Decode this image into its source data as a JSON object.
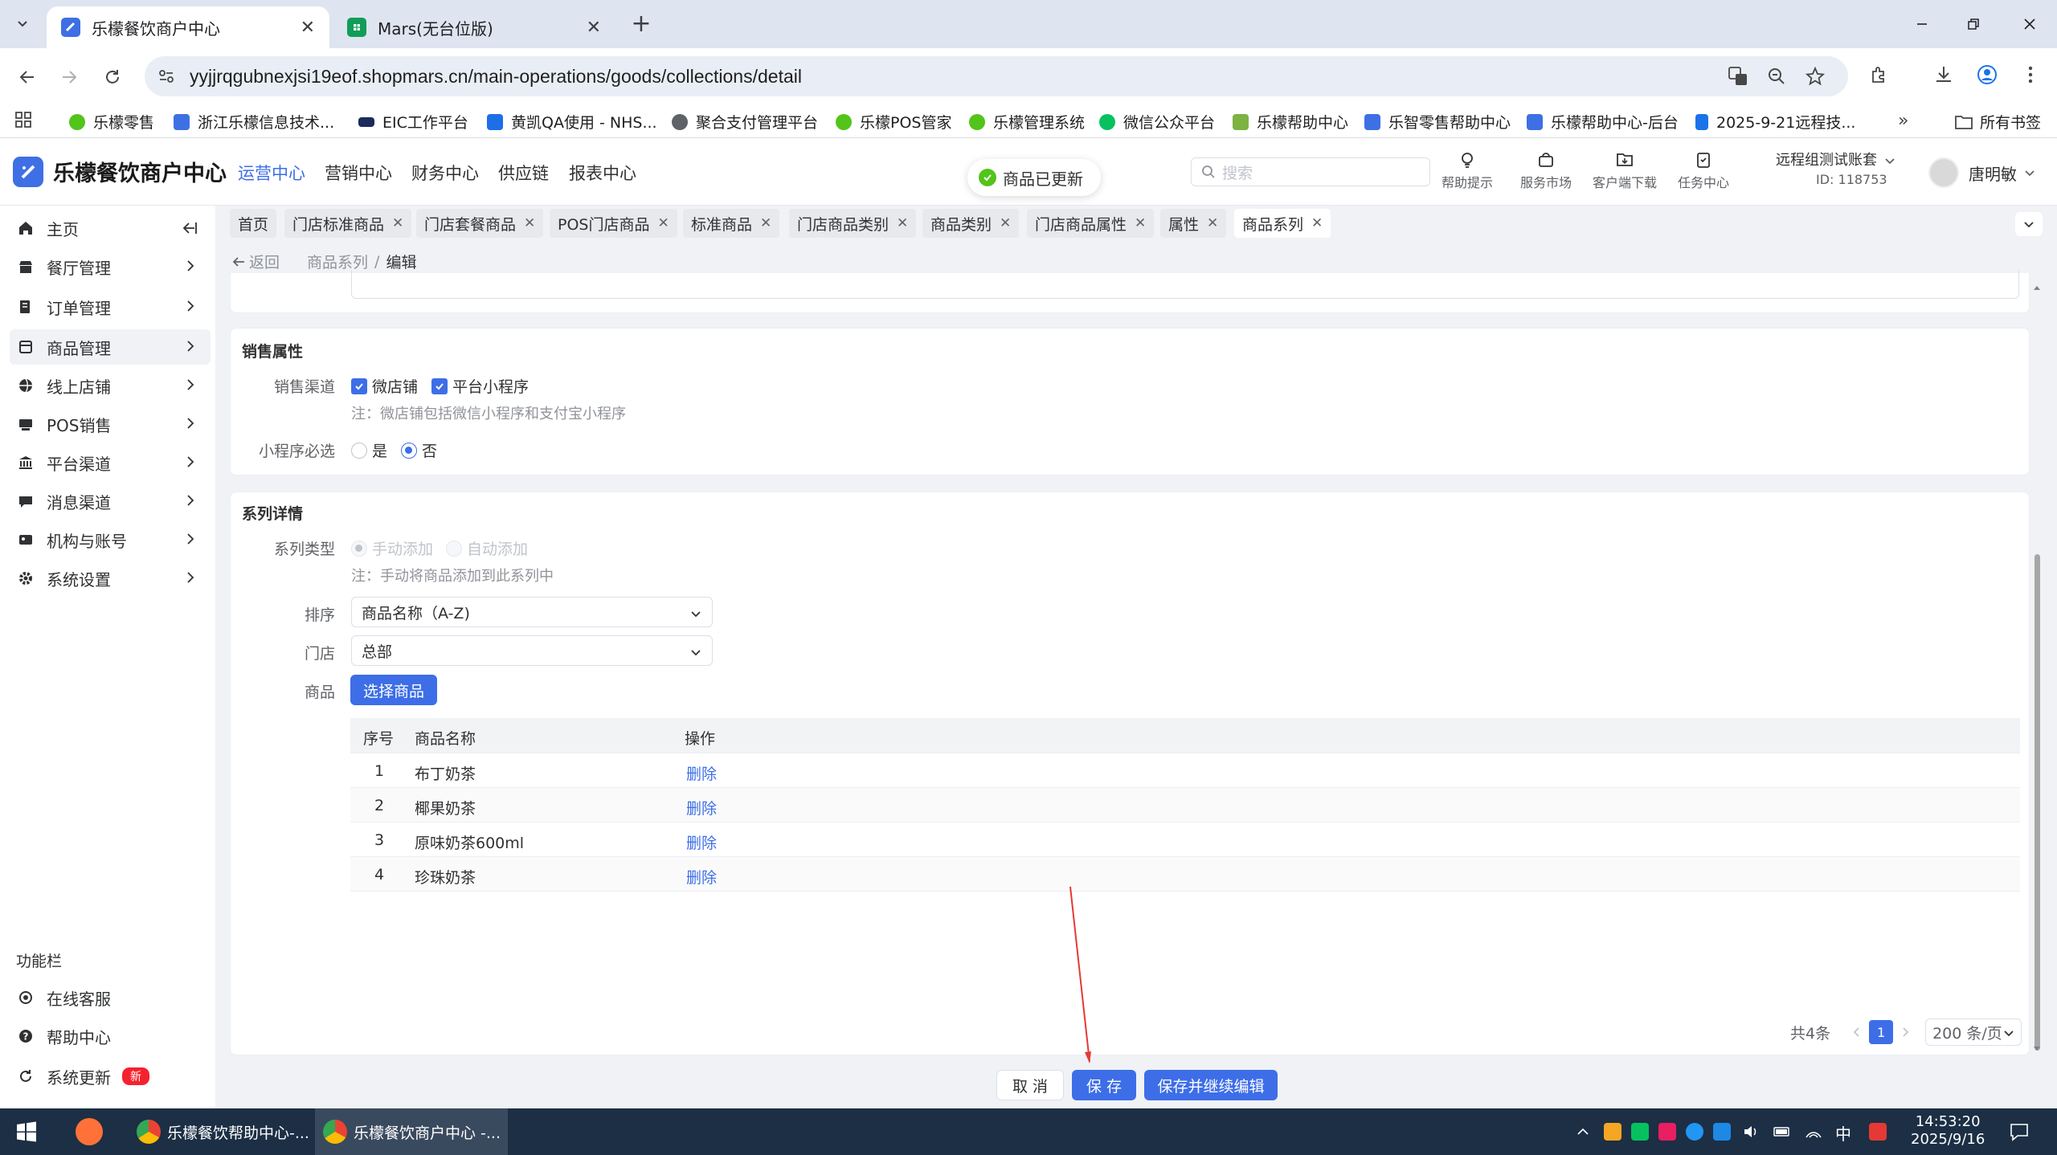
{
  "browser": {
    "tabs": [
      {
        "title": "乐檬餐饮商户中心",
        "active": true
      },
      {
        "title": "Mars(无台位版)",
        "active": false
      }
    ],
    "url": "yyjjrqgubnexjsi19eof.shopmars.cn/main-operations/goods/collections/detail"
  },
  "bookmarks": [
    "乐檬零售",
    "浙江乐檬信息技术...",
    "EIC工作平台",
    "黄凯QA使用 - NHS...",
    "聚合支付管理平台",
    "乐檬POS管家",
    "乐檬管理系统",
    "微信公众平台",
    "乐檬帮助中心",
    "乐智零售帮助中心",
    "乐檬帮助中心-后台",
    "2025-9-21远程技..."
  ],
  "bookmarks_folder": "所有书签",
  "app": {
    "name": "乐檬餐饮商户中心",
    "topnav": [
      "运营中心",
      "营销中心",
      "财务中心",
      "供应链",
      "报表中心"
    ],
    "toast": "商品已更新",
    "search_placeholder": "搜索",
    "header_icons": [
      "帮助提示",
      "服务市场",
      "客户端下载",
      "任务中心"
    ],
    "account_name": "远程组测试账套",
    "account_id": "ID: 118753",
    "user_name": "唐明敏"
  },
  "sidebar": {
    "items": [
      "主页",
      "餐厅管理",
      "订单管理",
      "商品管理",
      "线上店铺",
      "POS销售",
      "平台渠道",
      "消息渠道",
      "机构与账号",
      "系统设置"
    ],
    "func_title": "功能栏",
    "func_items": [
      "在线客服",
      "帮助中心",
      "系统更新"
    ],
    "new_badge": "新"
  },
  "page_tabs": [
    "首页",
    "门店标准商品",
    "门店套餐商品",
    "POS门店商品",
    "标准商品",
    "门店商品类别",
    "商品类别",
    "门店商品属性",
    "属性",
    "商品系列"
  ],
  "breadcrumb": {
    "back": "返回",
    "parent": "商品系列",
    "sep": "/",
    "current": "编辑"
  },
  "sales": {
    "title": "销售属性",
    "channel_label": "销售渠道",
    "channels": [
      "微店铺",
      "平台小程序"
    ],
    "channel_note": "注：微店铺包括微信小程序和支付宝小程序",
    "required_label": "小程序必选",
    "required_options": [
      "是",
      "否"
    ]
  },
  "series": {
    "title": "系列详情",
    "type_label": "系列类型",
    "type_options": [
      "手动添加",
      "自动添加"
    ],
    "type_note": "注：手动将商品添加到此系列中",
    "sort_label": "排序",
    "sort_value": "商品名称（A-Z)",
    "store_label": "门店",
    "store_value": "总部",
    "goods_label": "商品",
    "pick_button": "选择商品"
  },
  "table": {
    "headers": [
      "序号",
      "商品名称",
      "操作"
    ],
    "rows": [
      {
        "no": "1",
        "name": "布丁奶茶",
        "action": "删除"
      },
      {
        "no": "2",
        "name": "椰果奶茶",
        "action": "删除"
      },
      {
        "no": "3",
        "name": "原味奶茶600ml",
        "action": "删除"
      },
      {
        "no": "4",
        "name": "珍珠奶茶",
        "action": "删除"
      }
    ]
  },
  "pager": {
    "total": "共4条",
    "page": "1",
    "size": "200 条/页"
  },
  "footer": {
    "cancel": "取 消",
    "save": "保 存",
    "save_continue": "保存并继续编辑"
  },
  "taskbar": {
    "apps": [
      "乐檬餐饮帮助中心-...",
      "乐檬餐饮商户中心 -..."
    ],
    "ime": "中",
    "time": "14:53:20",
    "date": "2025/9/16"
  },
  "colors": {
    "accent": "#3d6ee8",
    "success": "#52c41a",
    "danger": "#f5222d",
    "taskbar": "#1c2f45"
  }
}
